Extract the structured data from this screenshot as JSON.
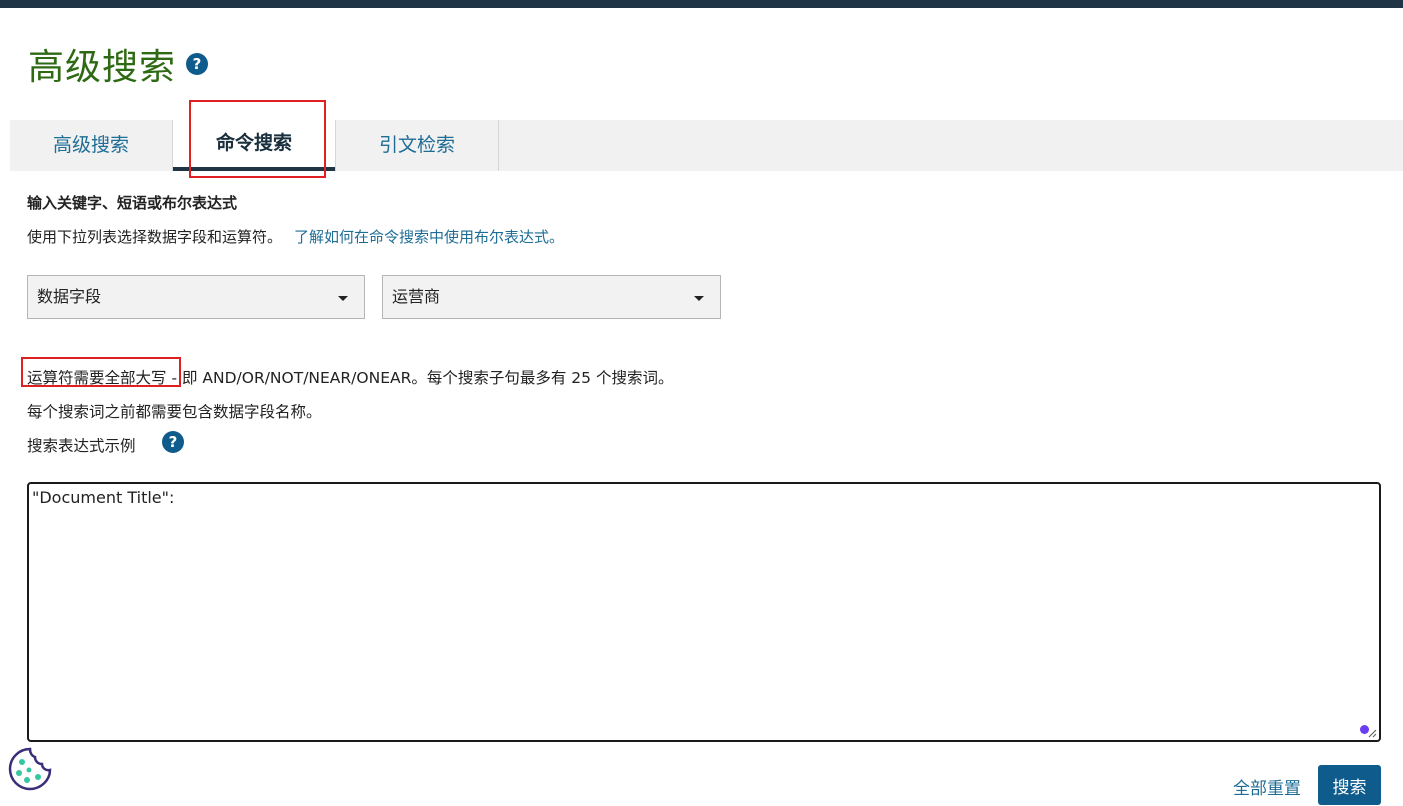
{
  "header": {
    "title": "高级搜索",
    "help_icon": "?"
  },
  "tabs": [
    {
      "label": "高级搜索",
      "active": false
    },
    {
      "label": "命令搜索",
      "active": true
    },
    {
      "label": "引文检索",
      "active": false
    }
  ],
  "instructions": {
    "heading": "输入关键字、短语或布尔表达式",
    "text": "使用下拉列表选择数据字段和运算符。",
    "link": "了解如何在命令搜索中使用布尔表达式。"
  },
  "dropdowns": {
    "field": {
      "selected": "数据字段"
    },
    "operator": {
      "selected": "运营商"
    }
  },
  "notes": {
    "operators_highlight": "运算符需要全部大写",
    "operators_rest": " - 即 AND/OR/NOT/NEAR/ONEAR。每个搜索子句最多有 25 个搜索词。",
    "field_name": "每个搜索词之前都需要包含数据字段名称。",
    "examples_label": "搜索表达式示例",
    "examples_help_icon": "?"
  },
  "query": {
    "value": "\"Document Title\":"
  },
  "actions": {
    "reset": "全部重置",
    "search": "搜索"
  },
  "colors": {
    "title_green": "#2e6a14",
    "link_blue": "#1e6d95",
    "primary_button": "#0f5c8c",
    "highlight_red": "#e02020",
    "topbar": "#1f3545"
  }
}
